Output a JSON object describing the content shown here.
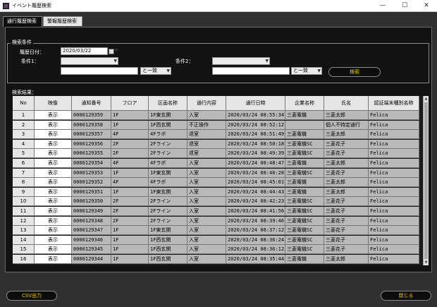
{
  "window": {
    "title": "イベント履歴検索",
    "minimize_glyph": "—",
    "maximize_glyph": "☐",
    "close_glyph": "✕"
  },
  "tabs": [
    {
      "label": "通行履歴検索",
      "active": true
    },
    {
      "label": "警報履歴検索",
      "active": false
    }
  ],
  "search": {
    "group_label": "検索条件",
    "date_label": "履歴日付：",
    "date_value": "2020/03/22",
    "cond1_label": "条件1：",
    "cond2_label": "条件2：",
    "cond1_select": "",
    "cond2_select": "",
    "cond1_text": "",
    "cond2_text": "",
    "cond1_match": "と一致",
    "cond2_match": "と一致",
    "search_button": "検索"
  },
  "results": {
    "label": "検索結果：",
    "columns": [
      "No",
      "映像",
      "通知番号",
      "フロア",
      "区画名称",
      "通行内容",
      "通行日時",
      "企業名称",
      "氏名",
      "認証端末種別名称"
    ],
    "rows": [
      [
        "1",
        "表示",
        "0000129359",
        "1F",
        "1F東玄関",
        "入室",
        "2020/03/24 08:55:34",
        "三菱電機",
        "三菱太郎",
        "Felica"
      ],
      [
        "2",
        "表示",
        "0000129358",
        "1F",
        "1F西玄関",
        "不正操作",
        "2020/03/24 08:52:12",
        "",
        "個人不特定通行",
        "Felica"
      ],
      [
        "3",
        "表示",
        "0000129357",
        "4F",
        "4Fラボ",
        "退室",
        "2020/03/24 08:51:49",
        "三菱電機",
        "三菱太郎",
        "Felica"
      ],
      [
        "4",
        "表示",
        "0000129356",
        "2F",
        "2Fライン",
        "退室",
        "2020/03/24 08:50:18",
        "三菱電機SC",
        "三菱花子",
        "Felica"
      ],
      [
        "5",
        "表示",
        "0000129355",
        "2F",
        "2Fライン",
        "退室",
        "2020/03/24 08:49:39",
        "三菱電機SC",
        "三菱花子",
        "Felica"
      ],
      [
        "6",
        "表示",
        "0000129354",
        "4F",
        "4Fラボ",
        "入室",
        "2020/03/24 08:48:47",
        "三菱電機",
        "三菱太郎",
        "Felica"
      ],
      [
        "7",
        "表示",
        "0000129353",
        "1F",
        "1F東玄関",
        "入室",
        "2020/03/24 08:48:28",
        "三菱電機SC",
        "三菱花子",
        "Felica"
      ],
      [
        "8",
        "表示",
        "0000129352",
        "4F",
        "4Fラボ",
        "入室",
        "2020/03/24 08:45:01",
        "三菱電機",
        "三菱太郎",
        "Felica"
      ],
      [
        "9",
        "表示",
        "0000129351",
        "1F",
        "1F東玄関",
        "入室",
        "2020/03/24 08:44:43",
        "三菱電機",
        "三菱太郎",
        "Felica"
      ],
      [
        "10",
        "表示",
        "0000129350",
        "2F",
        "2Fライン",
        "入室",
        "2020/03/24 08:42:23",
        "三菱電機SC",
        "三菱花子",
        "Felica"
      ],
      [
        "11",
        "表示",
        "0000129349",
        "2F",
        "2Fライン",
        "入室",
        "2020/03/24 08:41:56",
        "三菱電機SC",
        "三菱花子",
        "Felica"
      ],
      [
        "12",
        "表示",
        "0000129348",
        "2F",
        "2Fライン",
        "入室",
        "2020/03/24 08:39:46",
        "三菱電機SC",
        "三菱花子",
        "Felica"
      ],
      [
        "13",
        "表示",
        "0000129347",
        "1F",
        "1F東玄関",
        "入室",
        "2020/03/24 08:37:12",
        "三菱電機SC",
        "三菱花子",
        "Felica"
      ],
      [
        "14",
        "表示",
        "0000129346",
        "1F",
        "1F西玄関",
        "入室",
        "2020/03/24 08:36:24",
        "三菱電機SC",
        "三菱花子",
        "Felica"
      ],
      [
        "15",
        "表示",
        "0000129345",
        "1F",
        "1F西玄関",
        "入室",
        "2020/03/24 08:36:12",
        "三菱電機SC",
        "三菱花子",
        "Felica"
      ],
      [
        "16",
        "表示",
        "0000129344",
        "1F",
        "1F西玄関",
        "入室",
        "2020/03/24 08:35:44",
        "三菱電機",
        "三菱太郎",
        "Felica"
      ]
    ]
  },
  "footer": {
    "csv_button": "CSV出力",
    "close_button": "閉じる"
  },
  "colors": {
    "button_text": "#e8c800",
    "background": "#121212",
    "cell": "#b9b9b9"
  }
}
